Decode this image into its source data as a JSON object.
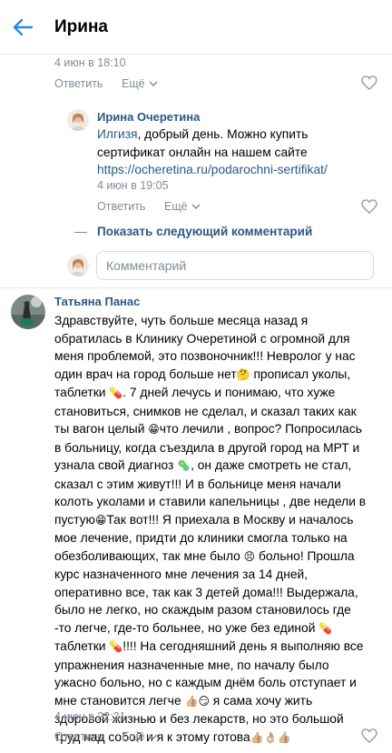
{
  "header": {
    "title": "Ирина"
  },
  "top_comment": {
    "time": "4 июн в 18:10",
    "reply_label": "Ответить",
    "more_label": "Ещё"
  },
  "reply": {
    "author": "Ирина Очеретина",
    "addressee": "Илгизя",
    "text_after": ", добрый день. Можно купить сертификат онлайн на нашем сайте",
    "url": "https://ocheretina.ru/podarochni-sertifikat/",
    "time": "4 июн в 19:05",
    "reply_label": "Ответить",
    "more_label": "Ещё"
  },
  "show_next": {
    "label": "Показать следующий комментарий"
  },
  "comment_input": {
    "placeholder": "Комментарий"
  },
  "comment": {
    "author": "Татьяна Панас",
    "lines": [
      "Здравствуйте, чуть больше месяца назад я",
      "обратилась в Клинику Очеретиной с огромной для",
      "меня проблемой, это позвоночник!!! Невролог у нас",
      "один врач на город больше нет",
      " прописал уколы,",
      "таблетки",
      ". 7 дней лечусь и понимаю, что хуже",
      "становиться, снимков не сделал, и сказал таких как",
      "ты вагон целый ",
      "что лечили , вопрос? Попросилась",
      "в больницу, когда съездила в другой город на МРТ и",
      "узнала свой диагноз ",
      ", он даже смотреть не стал,",
      "сказал с этим живут!!! И в больнице меня начали",
      "колоть уколами и ставили капельницы , две недели в",
      "пустую",
      "Так вот!!! Я приехала в Москву и началось",
      "мое лечение, придти до клиники смогла только на",
      "обезболивающих, так мне было ",
      " больно! Прошла",
      "курс назначенного мне лечения за 14 дней,",
      "оперативно все, так как 3 детей дома!!! Выдержала,",
      "было не легко, но скаждым разом становилось где",
      "-то легче, где-то больнее, но уже без единой ",
      "таблетки ",
      "!!!! На сегодняшний день я выполняю все",
      "упражнения назначенные мне, по началу было",
      "ужасно больно, но с каждым днём боль отступает и",
      "мне становится легче ",
      " я сама хочу жить",
      "здоровой жизнью и без лекарств, но это большой",
      "труд над собой и я к этому готова"
    ],
    "time": "4 июн в 22:21",
    "reply_label": "Ответить",
    "more_label": "Ещё"
  },
  "colors": {
    "link": "#2a5885",
    "muted": "#818c99",
    "accent": "#2688eb",
    "divider": "#e7e8ec"
  },
  "icons": [
    "back-arrow-icon",
    "chevron-down-icon",
    "heart-icon",
    "thinking-emoji",
    "pill-emoji",
    "grin-emoji",
    "microbe-emoji",
    "persevere-emoji",
    "thumbs-up-emoji",
    "ok-hand-emoji",
    "wink-emoji"
  ]
}
